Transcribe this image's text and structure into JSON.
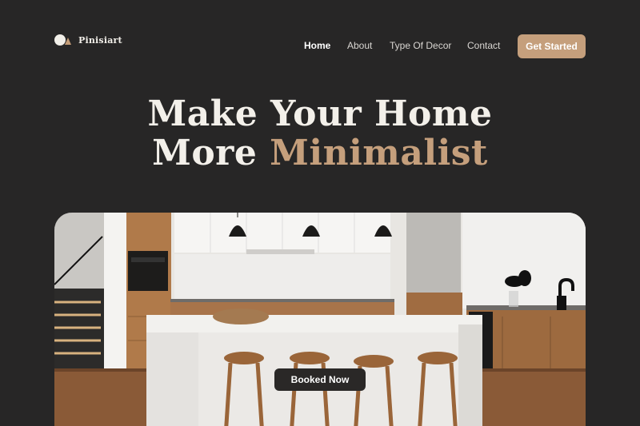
{
  "brand": {
    "name": "Pinisiart"
  },
  "nav": {
    "items": [
      {
        "label": "Home",
        "active": true
      },
      {
        "label": "About"
      },
      {
        "label": "Type Of Decor"
      },
      {
        "label": "Contact"
      }
    ],
    "cta_label": "Get Started"
  },
  "hero": {
    "line1": "Make Your Home",
    "line2_plain": "More ",
    "line2_accent": "Minimalist",
    "booked_label": "Booked Now"
  },
  "colors": {
    "background": "#272626",
    "accent": "#c59f7c",
    "text": "#f3f0ea"
  }
}
